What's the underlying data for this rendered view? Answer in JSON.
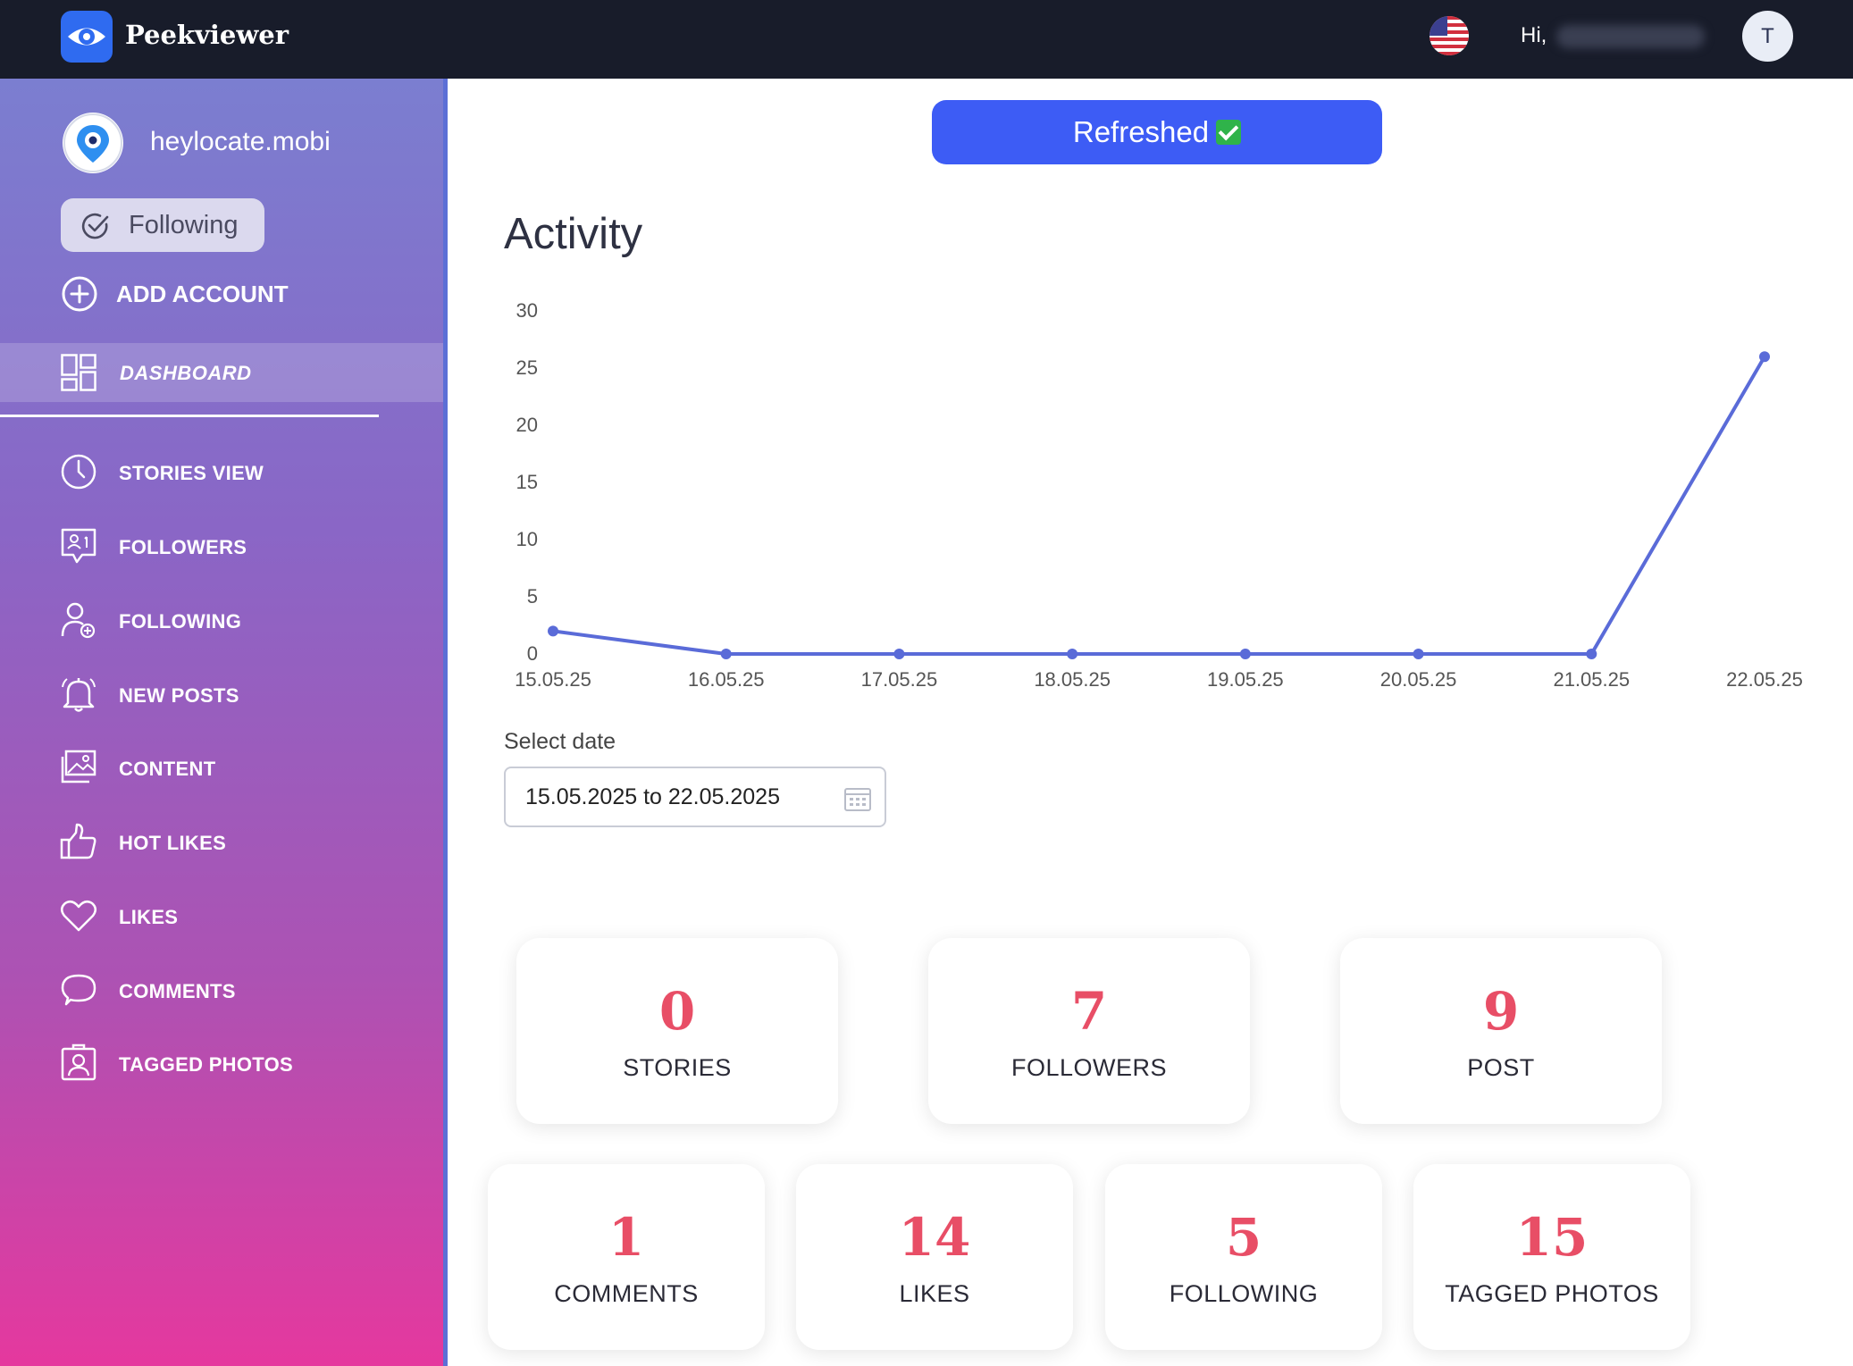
{
  "app": {
    "brand": "Peekviewer",
    "greeting": "Hi,",
    "avatar_initial": "T"
  },
  "account": {
    "name": "heylocate.mobi",
    "following_label": "Following",
    "add_account_label": "ADD ACCOUNT"
  },
  "sidebar": {
    "dashboard_label": "DASHBOARD",
    "items": [
      {
        "label": "STORIES VIEW",
        "icon": "clock-icon"
      },
      {
        "label": "FOLLOWERS",
        "icon": "followers-chat-icon"
      },
      {
        "label": "FOLLOWING",
        "icon": "user-add-icon"
      },
      {
        "label": "NEW POSTS",
        "icon": "bell-icon"
      },
      {
        "label": "CONTENT",
        "icon": "images-icon"
      },
      {
        "label": "HOT LIKES",
        "icon": "thumbs-up-icon"
      },
      {
        "label": "LIKES",
        "icon": "heart-icon"
      },
      {
        "label": "COMMENTS",
        "icon": "comment-icon"
      },
      {
        "label": "TAGGED PHOTOS",
        "icon": "tagged-user-icon"
      }
    ]
  },
  "main": {
    "refresh_label": "Refreshed",
    "activity_title": "Activity",
    "date_label": "Select date",
    "date_value": "15.05.2025 to 22.05.2025"
  },
  "chart_data": {
    "type": "line",
    "x": [
      "15.05.25",
      "16.05.25",
      "17.05.25",
      "18.05.25",
      "19.05.25",
      "20.05.25",
      "21.05.25",
      "22.05.25"
    ],
    "series": [
      {
        "values": [
          2,
          0,
          0,
          0,
          0,
          0,
          0,
          26
        ]
      }
    ],
    "yticks": [
      "0",
      "5",
      "10",
      "15",
      "20",
      "25",
      "30"
    ],
    "ylim": [
      0,
      30
    ],
    "grid": false,
    "color": "#5a6bd8"
  },
  "stats": [
    {
      "value": "0",
      "label": "STORIES"
    },
    {
      "value": "7",
      "label": "FOLLOWERS"
    },
    {
      "value": "9",
      "label": "POST"
    },
    {
      "value": "1",
      "label": "COMMENTS"
    },
    {
      "value": "14",
      "label": "LIKES"
    },
    {
      "value": "5",
      "label": "FOLLOWING"
    },
    {
      "value": "15",
      "label": "TAGGED PHOTOS"
    }
  ]
}
